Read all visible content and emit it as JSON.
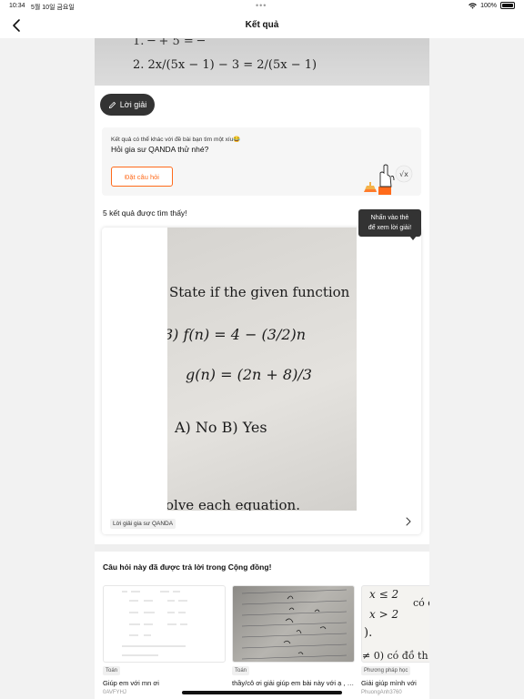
{
  "status_bar": {
    "time": "10:34",
    "date": "5월 10일 금요일",
    "dots": "•••",
    "battery": "100%"
  },
  "nav": {
    "title": "Kết quả"
  },
  "photo_top": {
    "line1": "1.  ─ + 5 = ─",
    "line2": "2.  2x/(5x − 1) − 3 = 2/(5x − 1)"
  },
  "solution_button": {
    "label": "Lời giải"
  },
  "ask_card": {
    "subtitle": "Kết quả có thể khác với đề bài bạn tìm một xíu😂",
    "title": "Hỏi gia sư QANDA thử nhé?",
    "button_label": "Đặt câu hỏi"
  },
  "results": {
    "count_label": "5 kết quả được tìm thấy!",
    "tooltip_line1": "Nhấn vào thẻ",
    "tooltip_line2": "để xem lời giải!",
    "card": {
      "photo_lines": [
        "State if the given function",
        "3)  f(n) = 4 − (3/2)n",
        "g(n) = (2n + 8)/3",
        "A)  No          B)  Yes",
        "olve each equation."
      ],
      "footer_label": "Lời giải gia sư QANDA"
    }
  },
  "community": {
    "title": "Câu hỏi này đã được trả lời trong Cộng đồng!",
    "items": [
      {
        "tag": "Toán",
        "text": "Giúp em với mn ơi",
        "user": "0AVFYHJ"
      },
      {
        "tag": "Toán",
        "text": "thầy/cô ơi giải giúp em bài này với ạ , em cảm ơn",
        "user": ""
      },
      {
        "tag": "Phương pháp học",
        "text": "Giải giúp mình với",
        "user": "PhuongAnh3760"
      }
    ],
    "thumb3_lines": [
      "x ≤ 2",
      "có đồ",
      "x > 2",
      ").",
      "≠ 0) có đồ th"
    ]
  },
  "colors": {
    "accent": "#ff6a1a",
    "dark": "#333333"
  }
}
